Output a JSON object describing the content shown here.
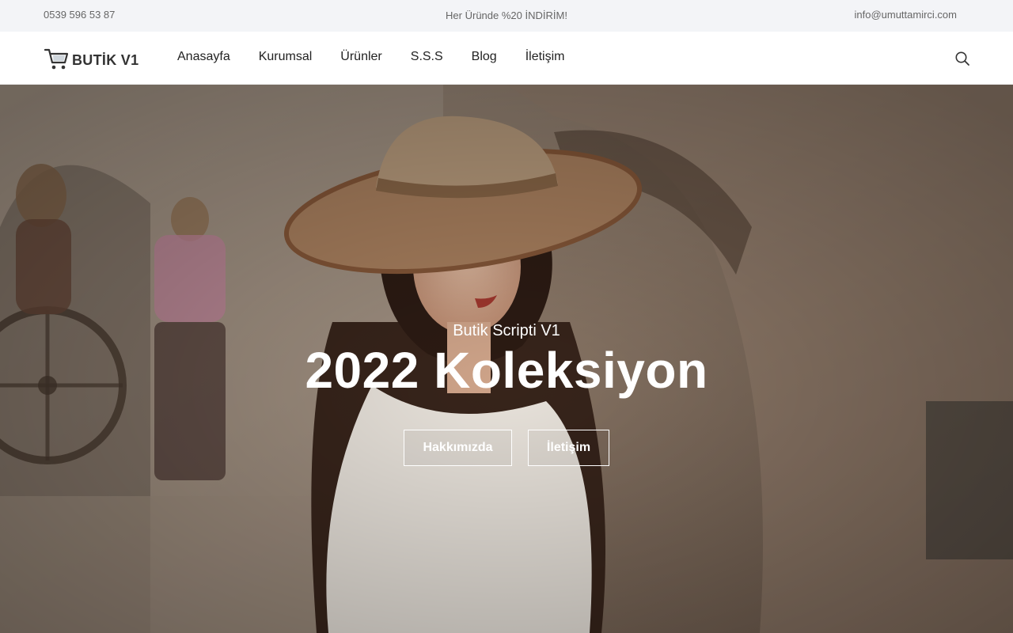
{
  "topbar": {
    "phone": "0539 596 53 87",
    "promo": "Her Üründe %20 İNDİRİM!",
    "email": "info@umuttamirci.com"
  },
  "header": {
    "logo_text": "BUTİK V1",
    "logo_icon": "shopping-cart-icon",
    "nav": [
      {
        "label": "Anasayfa"
      },
      {
        "label": "Kurumsal"
      },
      {
        "label": "Ürünler"
      },
      {
        "label": "S.S.S"
      },
      {
        "label": "Blog"
      },
      {
        "label": "İletişim"
      }
    ],
    "search_icon": "search-icon"
  },
  "hero": {
    "subtitle": "Butik Scripti V1",
    "title": "2022 Koleksiyon",
    "buttons": [
      {
        "label": "Hakkımızda"
      },
      {
        "label": "İletişim"
      }
    ]
  }
}
